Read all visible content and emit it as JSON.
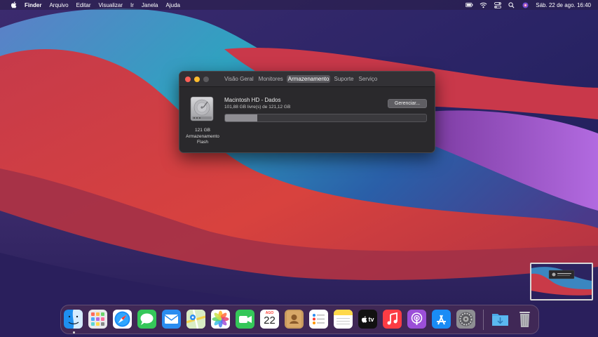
{
  "menubar": {
    "apple_icon": "apple-logo-icon",
    "app_name": "Finder",
    "menus": [
      "Arquivo",
      "Editar",
      "Visualizar",
      "Ir",
      "Janela",
      "Ajuda"
    ],
    "status_icons": [
      "battery-icon",
      "wifi-icon",
      "control-center-icon",
      "search-icon",
      "siri-icon"
    ],
    "datetime": "Sáb. 22 de ago.  16:40"
  },
  "window": {
    "tabs": [
      {
        "label": "Visão Geral",
        "active": false
      },
      {
        "label": "Monitores",
        "active": false
      },
      {
        "label": "Armazenamento",
        "active": true
      },
      {
        "label": "Suporte",
        "active": false
      },
      {
        "label": "Serviço",
        "active": false
      }
    ],
    "drive": {
      "capacity": "121 GB",
      "type": "Armazenamento Flash",
      "icon": "hard-drive-icon"
    },
    "volume_name": "Macintosh HD - Dados",
    "volume_free": "101,88 GB livre(s) de 121,12 GB",
    "manage_label": "Gerenciar...",
    "used_fraction": 0.159
  },
  "dock": {
    "items": [
      {
        "name": "finder",
        "icon": "finder-icon",
        "running": true
      },
      {
        "name": "launchpad",
        "icon": "launchpad-icon"
      },
      {
        "name": "safari",
        "icon": "safari-icon"
      },
      {
        "name": "messages",
        "icon": "messages-icon"
      },
      {
        "name": "mail",
        "icon": "mail-icon"
      },
      {
        "name": "maps",
        "icon": "maps-icon"
      },
      {
        "name": "photos",
        "icon": "photos-icon"
      },
      {
        "name": "facetime",
        "icon": "facetime-icon"
      },
      {
        "name": "calendar",
        "icon": "calendar-icon",
        "month": "AGO",
        "day": "22"
      },
      {
        "name": "contacts",
        "icon": "contacts-icon"
      },
      {
        "name": "reminders",
        "icon": "reminders-icon"
      },
      {
        "name": "notes",
        "icon": "notes-icon"
      },
      {
        "name": "apple-tv",
        "icon": "apple-tv-icon",
        "label": "tv"
      },
      {
        "name": "music",
        "icon": "music-icon"
      },
      {
        "name": "podcasts",
        "icon": "podcasts-icon"
      },
      {
        "name": "app-store",
        "icon": "app-store-icon"
      },
      {
        "name": "system-preferences",
        "icon": "system-preferences-icon"
      },
      {
        "name": "downloads",
        "icon": "downloads-folder-icon"
      },
      {
        "name": "trash",
        "icon": "trash-icon"
      }
    ]
  },
  "colors": {
    "accent_tab": "#58575c",
    "close": "#fe5f57",
    "minimize": "#febc2e"
  }
}
